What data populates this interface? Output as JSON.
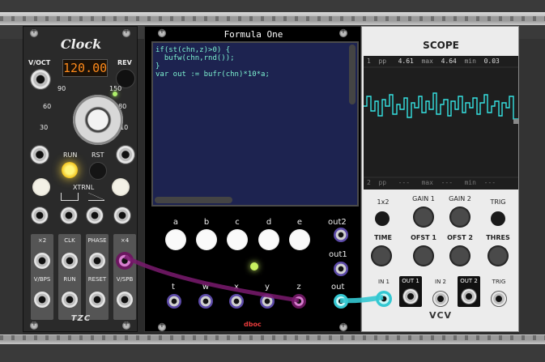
{
  "clock": {
    "title": "Clock",
    "bpm_display": "120.00",
    "labels": {
      "voct": "V/OCT",
      "rev": "REV",
      "run": "RUN",
      "rst": "RST",
      "xtrnl": "XTRNL"
    },
    "scale": [
      "90",
      "150",
      "60",
      "180",
      "30",
      "210"
    ],
    "grid_labels": [
      "×2",
      "CLK",
      "PHASE",
      "×4",
      "V/BPS",
      "RUN",
      "RESET",
      "V/SPB"
    ],
    "logo": "TZC"
  },
  "formula": {
    "title": "Formula One",
    "code_lines": [
      "if(st(chn,z)>0) {",
      "  bufw(chn,rnd());",
      "}",
      "var out := bufr(chn)*10*a;"
    ],
    "knob_labels": [
      "a",
      "b",
      "c",
      "d",
      "e"
    ],
    "out_labels": [
      "out2",
      "out1",
      "out"
    ],
    "input_labels": [
      "t",
      "w",
      "x",
      "y",
      "z"
    ],
    "logo": "dboc"
  },
  "scope": {
    "title": "SCOPE",
    "stats_top": {
      "ch": "1",
      "pp_label": "pp",
      "pp": "4.61",
      "max_label": "max",
      "max": "4.64",
      "min_label": "min",
      "min": "0.03"
    },
    "stats_bottom": {
      "ch": "2",
      "pp_label": "pp",
      "pp": "---",
      "max_label": "max",
      "max": "---",
      "min_label": "min",
      "min": "---"
    },
    "knob_labels": [
      "1x2",
      "GAIN 1",
      "GAIN 2",
      "TRIG",
      "TIME",
      "OFST 1",
      "OFST 2",
      "THRES"
    ],
    "jack_labels": [
      "IN 1",
      "OUT 1",
      "IN 2",
      "OUT 2",
      "TRIG"
    ],
    "brand": "VCV",
    "colors": {
      "trace": "#35e2e2"
    }
  },
  "cables": [
    {
      "from": "clock-x4",
      "to": "formula-z",
      "color": "#7a1a6e"
    },
    {
      "from": "formula-out",
      "to": "scope-in1",
      "color": "#34c8d2"
    }
  ]
}
